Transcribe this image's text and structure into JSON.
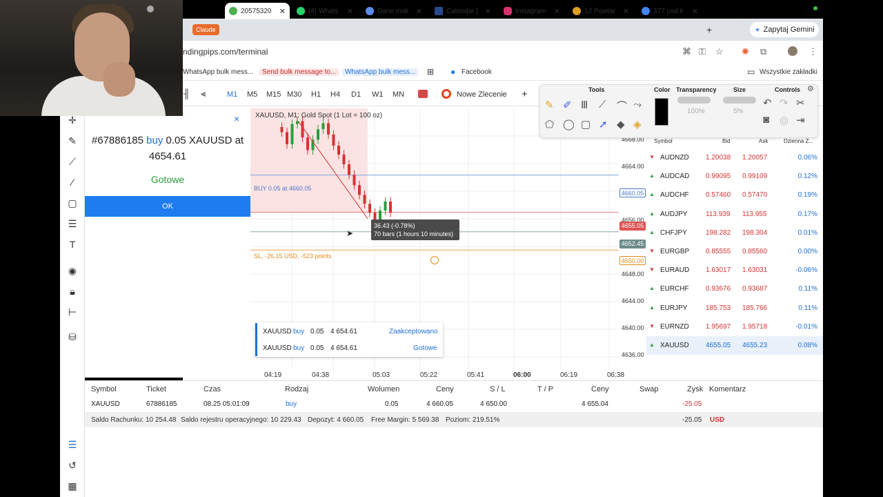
{
  "browser": {
    "claude_chip": "Claude",
    "tabs": [
      {
        "label": "20575320",
        "active": true
      },
      {
        "label": "(4) Whats"
      },
      {
        "label": "Dane mak"
      },
      {
        "label": "Calendar |"
      },
      {
        "label": "Instagram"
      },
      {
        "label": "12 Powtar"
      },
      {
        "label": "377 usd il"
      }
    ],
    "new_tab": "+",
    "gemini": "Zapytaj Gemini",
    "url": "ndingpips.com/terminal",
    "bookmarks": [
      "WhatsApp bulk mess...",
      "Send bulk message to...",
      "WhatsApp bulk mess...",
      "Facebook"
    ],
    "all_bookmarks": "Wszystkie zakładki"
  },
  "toolbar": {
    "timeframes": [
      "M1",
      "M5",
      "M15",
      "M30",
      "H1",
      "H4",
      "D1",
      "W1",
      "MN"
    ],
    "active_tf": "M1",
    "new_order": "Nowe Zlecenie",
    "add": "+"
  },
  "dialog": {
    "close": "×",
    "ticket": "#67886185",
    "side": "buy",
    "rest_line1": "0.05 XAUUSD at",
    "line2": "4654.61",
    "status": "Gotowe",
    "ok": "OK"
  },
  "chart": {
    "title": "XAUUSD, M1: Gold Spot (1 Lot = 100 oz)",
    "buy_line_label": "BUY 0.05 at 4660.05",
    "sl_label": "SL, -26.15 USD, -523 points",
    "tooltip_line1": "36.43 (-0.78%)",
    "tooltip_line2": "70 bars (1 hours 10 minutes)",
    "x_ticks": [
      "04:19",
      "04:38",
      "05:03",
      "05:22",
      "05:41",
      "06:00",
      "06:19",
      "06:38"
    ],
    "y_ticks": [
      "4668.00",
      "4664.00",
      "4656.00",
      "4648.00",
      "4644.00",
      "4640.00",
      "4636.00"
    ],
    "badges": {
      "buy": "4660.05",
      "bid": "4655.05",
      "ask": "4652.45",
      "sl": "4650.00"
    }
  },
  "chart_data": {
    "type": "candlestick",
    "symbol": "XAUUSD",
    "ylim": [
      4634,
      4669
    ],
    "prices": [
      4666.5,
      4665.8,
      4664.2,
      4666.9,
      4667.3,
      4665.1,
      4663.4,
      4664.8,
      4666.2,
      4667.0,
      4665.5,
      4664.0,
      4662.8,
      4661.5,
      4660.1,
      4658.7,
      4657.4,
      4656.2,
      4655.0,
      4653.8,
      4655.3,
      4656.5,
      4655.0
    ]
  },
  "order_popup": [
    {
      "symbol": "XAUUSD",
      "side": "buy",
      "volume": "0.05",
      "price": "4 654.61",
      "status": "Zaakceptowano"
    },
    {
      "symbol": "XAUUSD",
      "side": "buy",
      "volume": "0.05",
      "price": "4 654.61",
      "status": "Gotowe"
    }
  ],
  "palette": {
    "tools": "Tools",
    "color": "Color",
    "transparency": "Transparency",
    "transparency_val": "100%",
    "size": "Size",
    "size_val": "5%",
    "controls": "Controls"
  },
  "market_watch": {
    "headers": [
      "Symbol",
      "Bid",
      "Ask",
      "Dzienna Z..."
    ],
    "rows": [
      {
        "symbol": "AUDNZD",
        "bid": "1.20038",
        "ask": "1.20057",
        "change": "0.06%",
        "dir": "down"
      },
      {
        "symbol": "AUDCAD",
        "bid": "0.99095",
        "ask": "0.99109",
        "change": "0.12%",
        "dir": "up"
      },
      {
        "symbol": "AUDCHF",
        "bid": "0.57460",
        "ask": "0.57470",
        "change": "0.19%",
        "dir": "up"
      },
      {
        "symbol": "AUDJPY",
        "bid": "113.939",
        "ask": "113.955",
        "change": "0.17%",
        "dir": "up"
      },
      {
        "symbol": "CHFJPY",
        "bid": "198.282",
        "ask": "198.304",
        "change": "0.01%",
        "dir": "up"
      },
      {
        "symbol": "EURGBP",
        "bid": "0.85555",
        "ask": "0.85560",
        "change": "0.00%",
        "dir": "down"
      },
      {
        "symbol": "EURAUD",
        "bid": "1.63017",
        "ask": "1.63031",
        "change": "-0.06%",
        "dir": "down"
      },
      {
        "symbol": "EURCHF",
        "bid": "0.93676",
        "ask": "0.93687",
        "change": "0.11%",
        "dir": "up"
      },
      {
        "symbol": "EURJPY",
        "bid": "185.753",
        "ask": "185.766",
        "change": "0.11%",
        "dir": "up"
      },
      {
        "symbol": "EURNZD",
        "bid": "1.95697",
        "ask": "1.95718",
        "change": "-0.01%",
        "dir": "down"
      },
      {
        "symbol": "XAUUSD",
        "bid": "4655.05",
        "ask": "4655.23",
        "change": "0.08%",
        "dir": "up"
      }
    ]
  },
  "positions": {
    "headers": [
      "Symbol",
      "Ticket",
      "Czas",
      "Rodzaj",
      "Wolumen",
      "Ceny",
      "S / L",
      "T / P",
      "Ceny",
      "Swap",
      "Zysk",
      "Komentarz"
    ],
    "row": {
      "symbol": "XAUUSD",
      "ticket": "67886185",
      "time": "08.25 05:01:09",
      "type": "buy",
      "volume": "0.05",
      "open": "4 660.05",
      "sl": "4 650.00",
      "tp": "",
      "price": "4 655.04",
      "swap": "",
      "profit": "-25.05"
    },
    "summary": {
      "balance": "Saldo Rachunku: 10 254.48",
      "equity": "Saldo rejestru operacyjnego: 10 229.43",
      "deposit": "Depozyt: 4 660.05",
      "free_margin": "Free Margin: 5 569.38",
      "level": "Poziom: 219.51%",
      "profit": "-25.05",
      "currency": "USD"
    }
  }
}
